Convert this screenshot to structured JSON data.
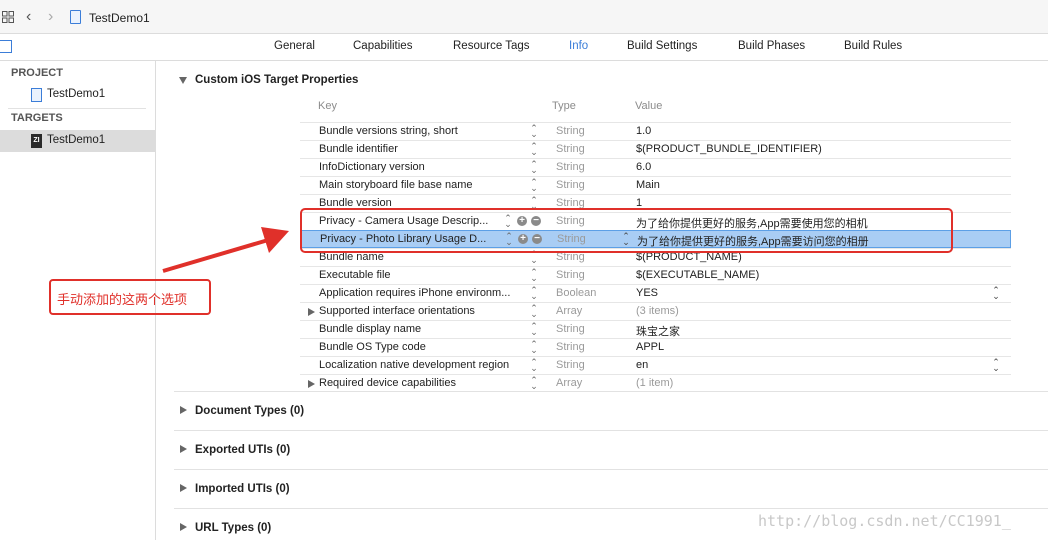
{
  "window": {
    "title": "TestDemo1"
  },
  "tabs": [
    "General",
    "Capabilities",
    "Resource Tags",
    "Info",
    "Build Settings",
    "Build Phases",
    "Build Rules"
  ],
  "active_tab": "Info",
  "sidebar": {
    "project_header": "PROJECT",
    "project_item": "TestDemo1",
    "targets_header": "TARGETS",
    "target_item": "TestDemo1"
  },
  "custom_props": {
    "title": "Custom iOS Target Properties",
    "columns": {
      "key": "Key",
      "type": "Type",
      "value": "Value"
    },
    "rows": [
      {
        "key": "Bundle versions string, short",
        "type": "String",
        "value": "1.0"
      },
      {
        "key": "Bundle identifier",
        "type": "String",
        "value": "$(PRODUCT_BUNDLE_IDENTIFIER)"
      },
      {
        "key": "InfoDictionary version",
        "type": "String",
        "value": "6.0"
      },
      {
        "key": "Main storyboard file base name",
        "type": "String",
        "value": "Main"
      },
      {
        "key": "Bundle version",
        "type": "String",
        "value": "1"
      },
      {
        "key": "Privacy - Camera Usage Descrip...",
        "type": "String",
        "value": "为了给你提供更好的服务,App需要使用您的相机"
      },
      {
        "key": "Privacy - Photo Library Usage D...",
        "type": "String",
        "value": "为了给你提供更好的服务,App需要访问您的相册"
      },
      {
        "key": "Bundle name",
        "type": "String",
        "value": "$(PRODUCT_NAME)"
      },
      {
        "key": "Executable file",
        "type": "String",
        "value": "$(EXECUTABLE_NAME)"
      },
      {
        "key": "Application requires iPhone environm...",
        "type": "Boolean",
        "value": "YES"
      },
      {
        "key": "Supported interface orientations",
        "type": "Array",
        "value": "(3 items)"
      },
      {
        "key": "Bundle display name",
        "type": "String",
        "value": "珠宝之家"
      },
      {
        "key": "Bundle OS Type code",
        "type": "String",
        "value": "APPL"
      },
      {
        "key": "Localization native development region",
        "type": "String",
        "value": "en"
      },
      {
        "key": "Required device capabilities",
        "type": "Array",
        "value": "(1 item)"
      }
    ]
  },
  "sections": [
    {
      "label": "Document Types (0)"
    },
    {
      "label": "Exported UTIs (0)"
    },
    {
      "label": "Imported UTIs (0)"
    },
    {
      "label": "URL Types (0)"
    }
  ],
  "annotation": {
    "text": "手动添加的这两个选项",
    "color": "#e0302a"
  },
  "watermark": "http://blog.csdn.net/CC1991_",
  "colors": {
    "accent": "#3b7dd8",
    "selection": "#a9cdf4"
  }
}
